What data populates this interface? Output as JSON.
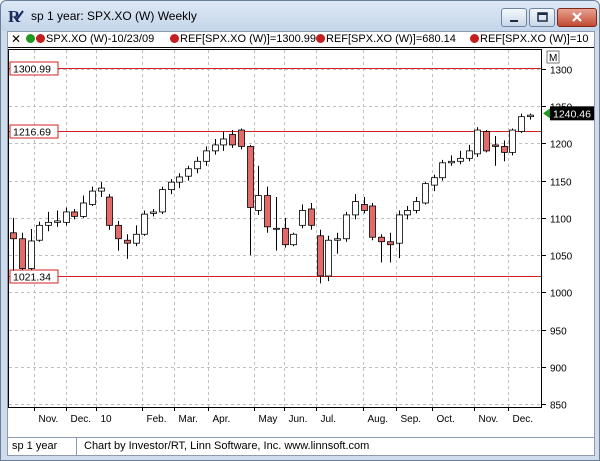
{
  "window": {
    "title": "sp 1 year: SPX.XO (W) Weekly"
  },
  "legend": [
    {
      "text": "SPX.XO (W)-10/23/09",
      "icon": "two-dots-icon"
    },
    {
      "text": "REF[SPX.XO (W)]=1300.99",
      "icon": "red-dot-icon"
    },
    {
      "text": "REF[SPX.XO (W)]=680.14",
      "icon": "red-dot-icon"
    },
    {
      "text": "REF[SPX.XO (W)]=10",
      "icon": "red-dot-icon"
    }
  ],
  "colors": {
    "up_candle": "#ffffff",
    "down_candle": "#e26a6a",
    "ref_line": "#d62020",
    "grid": "#bfbfbf",
    "last_price_marker": "#1f9a1f"
  },
  "reference_lines": [
    {
      "label": "1300.99",
      "value": 1300.99
    },
    {
      "label": "1216.69",
      "value": 1216.69
    },
    {
      "label": "1021.34",
      "value": 1021.34
    }
  ],
  "last_price": {
    "label": "1240.46",
    "value": 1240.46
  },
  "status": {
    "left": "sp 1 year",
    "right": "Chart by Investor/RT, Linn Software, Inc. www.linnsoft.com"
  },
  "chart_data": {
    "type": "candlestick",
    "y_axis": {
      "min": 850,
      "max": 1300,
      "ticks": [
        850,
        900,
        950,
        1000,
        1050,
        1100,
        1150,
        1200,
        1250,
        1300
      ],
      "side": "right"
    },
    "x_tick_labels": [
      "Nov.",
      "Dec.",
      "10",
      "Feb.",
      "Mar.",
      "Apr.",
      "May",
      "Jun.",
      "Jul.",
      "Aug.",
      "Sep.",
      "Oct.",
      "Nov.",
      "Dec."
    ],
    "candles": [
      {
        "o": 1080,
        "h": 1100,
        "l": 1029,
        "c": 1072
      },
      {
        "o": 1072,
        "h": 1080,
        "l": 1030,
        "c": 1032
      },
      {
        "o": 1032,
        "h": 1085,
        "l": 1030,
        "c": 1069
      },
      {
        "o": 1070,
        "h": 1095,
        "l": 1068,
        "c": 1090
      },
      {
        "o": 1090,
        "h": 1108,
        "l": 1082,
        "c": 1094
      },
      {
        "o": 1094,
        "h": 1110,
        "l": 1088,
        "c": 1096
      },
      {
        "o": 1094,
        "h": 1114,
        "l": 1090,
        "c": 1108
      },
      {
        "o": 1108,
        "h": 1112,
        "l": 1098,
        "c": 1102
      },
      {
        "o": 1102,
        "h": 1130,
        "l": 1100,
        "c": 1120
      },
      {
        "o": 1118,
        "h": 1142,
        "l": 1116,
        "c": 1136
      },
      {
        "o": 1136,
        "h": 1148,
        "l": 1128,
        "c": 1140
      },
      {
        "o": 1128,
        "h": 1132,
        "l": 1084,
        "c": 1090
      },
      {
        "o": 1090,
        "h": 1096,
        "l": 1056,
        "c": 1072
      },
      {
        "o": 1070,
        "h": 1078,
        "l": 1045,
        "c": 1066
      },
      {
        "o": 1066,
        "h": 1090,
        "l": 1062,
        "c": 1078
      },
      {
        "o": 1078,
        "h": 1110,
        "l": 1076,
        "c": 1105
      },
      {
        "o": 1106,
        "h": 1112,
        "l": 1102,
        "c": 1108
      },
      {
        "o": 1108,
        "h": 1142,
        "l": 1105,
        "c": 1138
      },
      {
        "o": 1138,
        "h": 1152,
        "l": 1132,
        "c": 1148
      },
      {
        "o": 1148,
        "h": 1160,
        "l": 1140,
        "c": 1155
      },
      {
        "o": 1156,
        "h": 1170,
        "l": 1150,
        "c": 1166
      },
      {
        "o": 1166,
        "h": 1182,
        "l": 1160,
        "c": 1176
      },
      {
        "o": 1176,
        "h": 1196,
        "l": 1170,
        "c": 1190
      },
      {
        "o": 1190,
        "h": 1206,
        "l": 1185,
        "c": 1198
      },
      {
        "o": 1198,
        "h": 1216,
        "l": 1190,
        "c": 1206
      },
      {
        "o": 1212,
        "h": 1218,
        "l": 1194,
        "c": 1198
      },
      {
        "o": 1218,
        "h": 1220,
        "l": 1192,
        "c": 1196
      },
      {
        "o": 1196,
        "h": 1198,
        "l": 1050,
        "c": 1114
      },
      {
        "o": 1110,
        "h": 1170,
        "l": 1104,
        "c": 1130
      },
      {
        "o": 1130,
        "h": 1142,
        "l": 1080,
        "c": 1088
      },
      {
        "o": 1085,
        "h": 1128,
        "l": 1056,
        "c": 1086
      },
      {
        "o": 1086,
        "h": 1100,
        "l": 1060,
        "c": 1064
      },
      {
        "o": 1064,
        "h": 1080,
        "l": 1062,
        "c": 1078
      },
      {
        "o": 1090,
        "h": 1118,
        "l": 1086,
        "c": 1110
      },
      {
        "o": 1112,
        "h": 1120,
        "l": 1084,
        "c": 1090
      },
      {
        "o": 1076,
        "h": 1084,
        "l": 1012,
        "c": 1022
      },
      {
        "o": 1022,
        "h": 1076,
        "l": 1015,
        "c": 1070
      },
      {
        "o": 1070,
        "h": 1080,
        "l": 1052,
        "c": 1072
      },
      {
        "o": 1072,
        "h": 1108,
        "l": 1068,
        "c": 1104
      },
      {
        "o": 1104,
        "h": 1132,
        "l": 1098,
        "c": 1122
      },
      {
        "o": 1118,
        "h": 1128,
        "l": 1106,
        "c": 1110
      },
      {
        "o": 1116,
        "h": 1120,
        "l": 1070,
        "c": 1074
      },
      {
        "o": 1074,
        "h": 1078,
        "l": 1040,
        "c": 1068
      },
      {
        "o": 1068,
        "h": 1080,
        "l": 1040,
        "c": 1064
      },
      {
        "o": 1066,
        "h": 1110,
        "l": 1046,
        "c": 1104
      },
      {
        "o": 1104,
        "h": 1116,
        "l": 1098,
        "c": 1110
      },
      {
        "o": 1110,
        "h": 1128,
        "l": 1106,
        "c": 1122
      },
      {
        "o": 1120,
        "h": 1148,
        "l": 1118,
        "c": 1146
      },
      {
        "o": 1144,
        "h": 1158,
        "l": 1136,
        "c": 1154
      },
      {
        "o": 1154,
        "h": 1178,
        "l": 1150,
        "c": 1174
      },
      {
        "o": 1174,
        "h": 1184,
        "l": 1170,
        "c": 1176
      },
      {
        "o": 1176,
        "h": 1190,
        "l": 1172,
        "c": 1180
      },
      {
        "o": 1180,
        "h": 1198,
        "l": 1176,
        "c": 1190
      },
      {
        "o": 1186,
        "h": 1222,
        "l": 1182,
        "c": 1218
      },
      {
        "o": 1216,
        "h": 1218,
        "l": 1188,
        "c": 1190
      },
      {
        "o": 1198,
        "h": 1210,
        "l": 1170,
        "c": 1196
      },
      {
        "o": 1196,
        "h": 1204,
        "l": 1176,
        "c": 1188
      },
      {
        "o": 1188,
        "h": 1220,
        "l": 1184,
        "c": 1218
      },
      {
        "o": 1216,
        "h": 1240,
        "l": 1214,
        "c": 1236
      },
      {
        "o": 1236,
        "h": 1240,
        "l": 1232,
        "c": 1238
      }
    ]
  }
}
